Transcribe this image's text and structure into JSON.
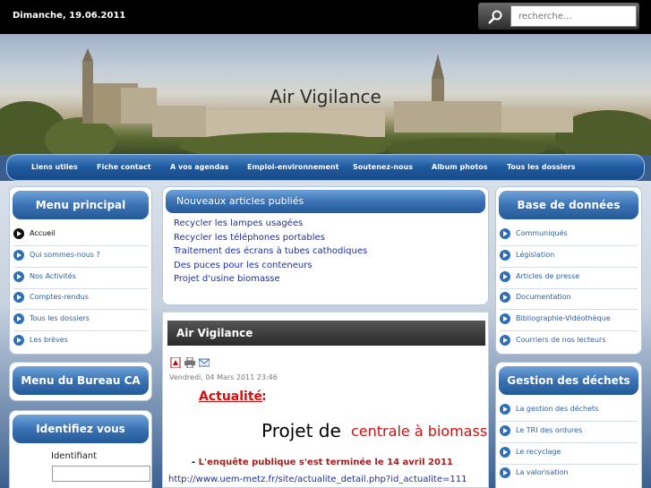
{
  "topbar": {
    "date": "Dimanche, 19.06.2011"
  },
  "search": {
    "placeholder": "recherche..."
  },
  "banner": {
    "title": "Air Vigilance"
  },
  "nav": {
    "items": [
      "Liens utiles",
      "Fiche contact",
      "A vos agendas",
      "Emploi-environnement",
      "Soutenez-nous",
      "Album photos",
      "Tous les dossiers"
    ]
  },
  "left": {
    "menu_title": "Menu principal",
    "menu_items": [
      "Accueil",
      "Qui sommes-nous ?",
      "Nos Activités",
      "Comptes-rendus",
      "Tous les dossiers",
      "Les brèves"
    ],
    "bureau_title": "Menu du Bureau CA",
    "login_title": "Identifiez vous",
    "login_label": "Identifiant"
  },
  "news": {
    "title": "Nouveaux articles publiés",
    "links": [
      "Recycler les lampes usagées",
      "Recycler les téléphones portables",
      "Traitement des écrans à tubes cathodiques",
      "Des puces pour les conteneurs",
      "Projet d'usine biomasse"
    ]
  },
  "article": {
    "title": "Air Vigilance",
    "date": "Vendredi, 04 Mars 2011 23:46",
    "category": "Actualité",
    "colon": ":",
    "big_black": "Projet de",
    "big_red": "centrale à biomasse",
    "line_dash": "-",
    "line": "L'enquête publique s'est terminée le 14 avril 2011",
    "url": "http://www.uem-metz.fr/site/actualite_detail.php?id_actualite=111"
  },
  "right": {
    "db_title": "Base de données",
    "db_items": [
      "Communiqués",
      "Législation",
      "Articles de presse",
      "Documentation",
      "Bibliographie-Vidéothèque",
      "Courriers de nos lecteurs"
    ],
    "waste_title": "Gestion des déchets",
    "waste_items": [
      "La gestion des déchets",
      "Le TRI des ordures",
      "Le recyclage",
      "La valorisation"
    ]
  },
  "colors": {
    "nav_blue": "#1e5a9f",
    "link_blue": "#1c2fa0",
    "accent_red": "#d01010"
  }
}
